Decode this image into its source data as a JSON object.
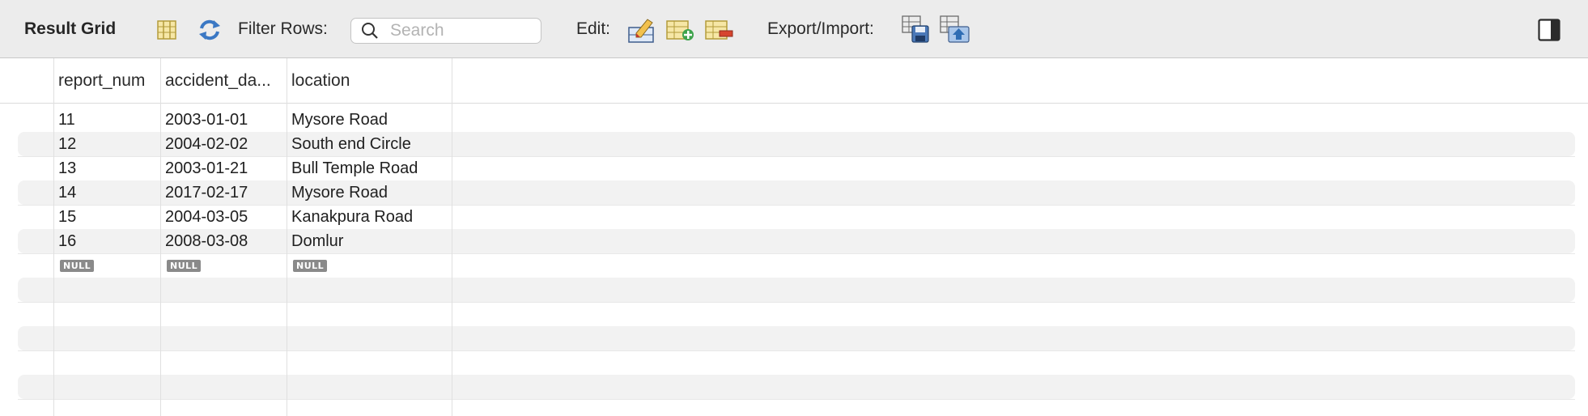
{
  "toolbar": {
    "title": "Result Grid",
    "filter_label": "Filter Rows:",
    "search_placeholder": "Search",
    "edit_label": "Edit:",
    "export_label": "Export/Import:"
  },
  "grid": {
    "columns": [
      "report_num",
      "accident_da...",
      "location"
    ],
    "rows": [
      [
        "11",
        "2003-01-01",
        "Mysore Road"
      ],
      [
        "12",
        "2004-02-02",
        "South end Circle"
      ],
      [
        "13",
        "2003-01-21",
        "Bull Temple Road"
      ],
      [
        "14",
        "2017-02-17",
        "Mysore Road"
      ],
      [
        "15",
        "2004-03-05",
        "Kanakpura Road"
      ],
      [
        "16",
        "2008-03-08",
        "Domlur"
      ]
    ],
    "null_label": "NULL"
  }
}
